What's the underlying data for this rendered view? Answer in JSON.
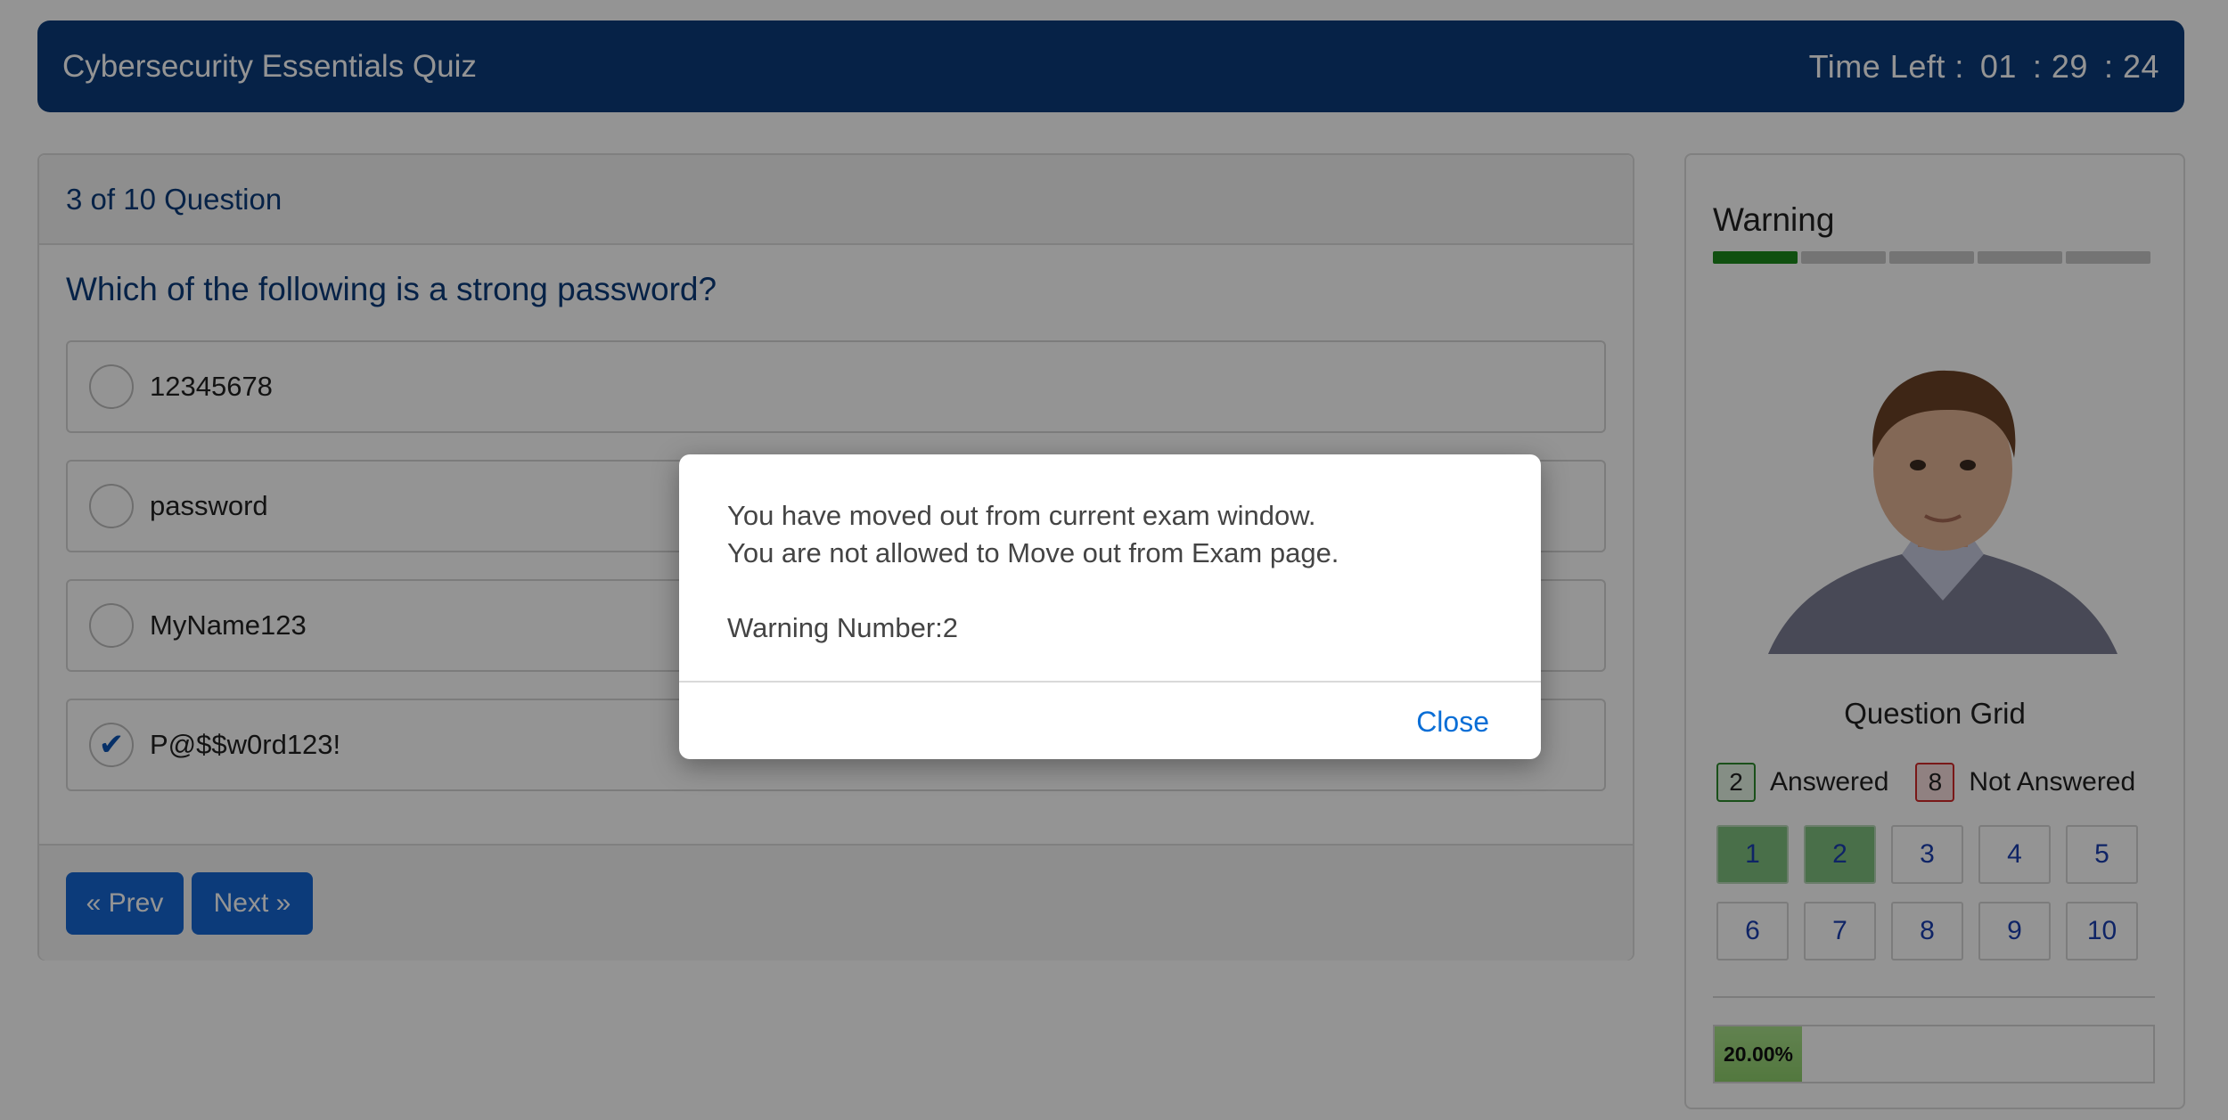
{
  "header": {
    "title": "Cybersecurity Essentials Quiz",
    "time_label": "Time Left :",
    "hours": "01",
    "minutes": ": 29",
    "seconds": ": 24"
  },
  "question": {
    "counter": "3 of 10 Question",
    "text": "Which of the following is a strong password?",
    "options": [
      {
        "label": "12345678",
        "selected": false
      },
      {
        "label": "password",
        "selected": false
      },
      {
        "label": "MyName123",
        "selected": false
      },
      {
        "label": "P@$$w0rd123!",
        "selected": true
      }
    ],
    "prev_label": "« Prev",
    "next_label": "Next »"
  },
  "sidebar": {
    "warning_title": "Warning",
    "warning_level": 1,
    "warning_max": 5,
    "grid_title": "Question Grid",
    "answered_count": "2",
    "answered_label": "Answered",
    "not_answered_count": "8",
    "not_answered_label": "Not Answered",
    "grid": [
      "1",
      "2",
      "3",
      "4",
      "5",
      "6",
      "7",
      "8",
      "9",
      "10"
    ],
    "answered": [
      "1",
      "2"
    ],
    "progress_text": "20.00%",
    "progress_value": 0.2
  },
  "modal": {
    "line1": "You have moved out from current exam window.",
    "line2": "You are not allowed to Move out from Exam page.",
    "line3": "Warning Number:2",
    "close_label": "Close"
  },
  "colors": {
    "header_bg": "#0c3b7a",
    "button_bg": "#1666d2",
    "answered_bg": "#7fbf7f",
    "warning_on": "#1c8a1c",
    "link": "#0a6ed6"
  }
}
